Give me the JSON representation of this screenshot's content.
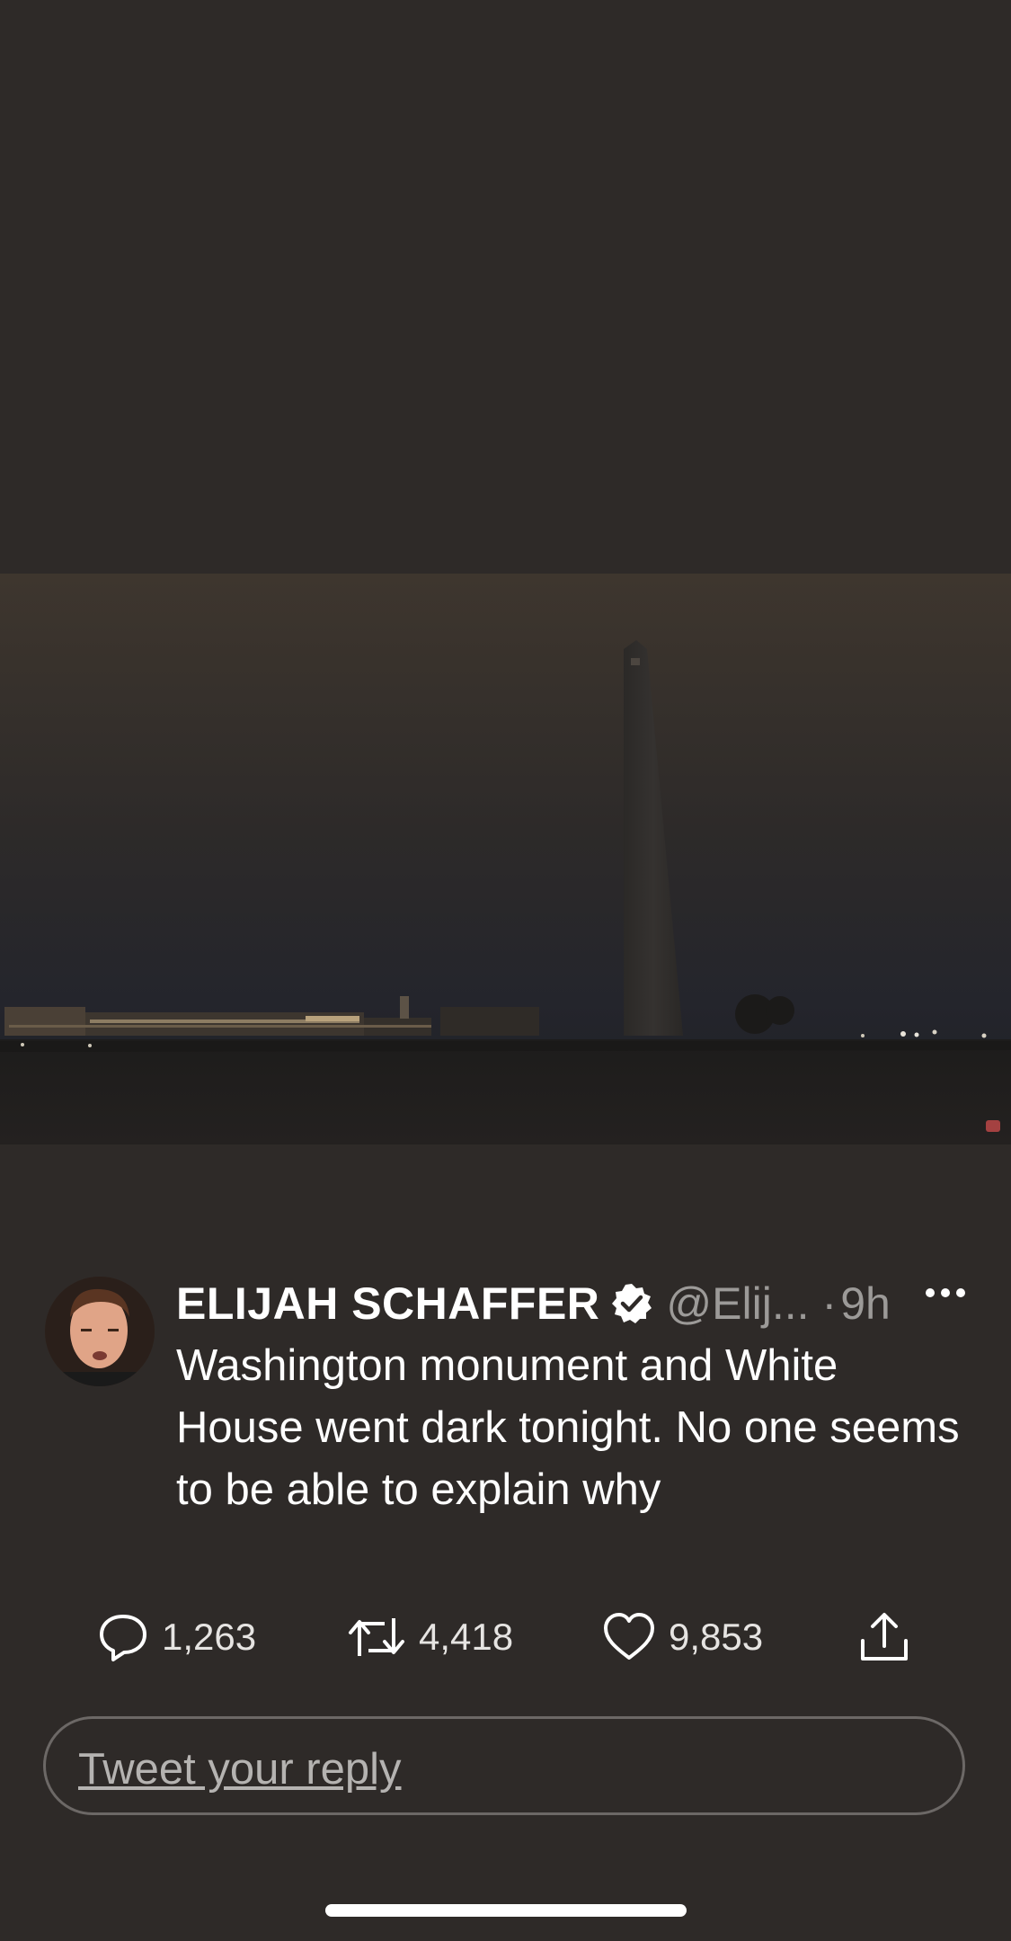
{
  "tweet": {
    "author_name": "ELIJAH SCHAFFER",
    "handle": "@Elij...",
    "separator": "·",
    "time": "9h",
    "text": "Washington monument and White House went dark tonight. No one seems to be able to explain why"
  },
  "actions": {
    "reply_count": "1,263",
    "retweet_count": "4,418",
    "like_count": "9,853"
  },
  "reply": {
    "placeholder": "Tweet your reply"
  },
  "icons": {
    "verified": "verified-badge-icon",
    "more": "more-icon",
    "reply": "reply-icon",
    "retweet": "retweet-icon",
    "like": "heart-icon",
    "share": "share-icon"
  },
  "colors": {
    "background": "#2e2a28",
    "text": "#ffffff",
    "secondary_text": "#9c9a98"
  }
}
